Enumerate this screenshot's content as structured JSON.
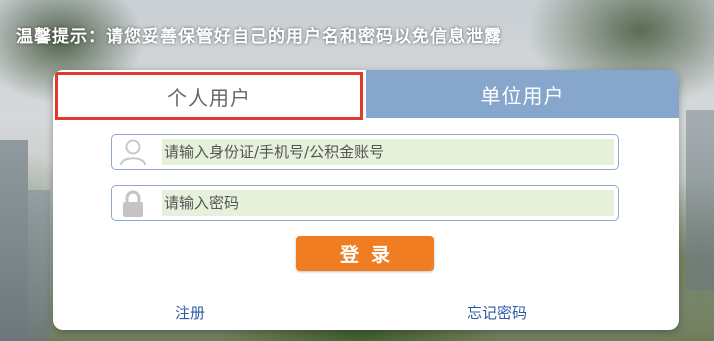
{
  "tip": "温馨提示：请您妥善保管好自己的用户名和密码以免信息泄露",
  "tabs": {
    "personal": "个人用户",
    "unit": "单位用户"
  },
  "form": {
    "username_placeholder": "请输入身份证/手机号/公积金账号",
    "password_placeholder": "请输入密码",
    "login_label": "登录"
  },
  "links": {
    "register": "注册",
    "forgot": "忘记密码"
  },
  "colors": {
    "active_tab_border": "#e03a2e",
    "inactive_tab_bg": "#87a6cc",
    "login_button": "#f07d22",
    "link": "#2d5aa5",
    "input_fill": "#e6f1dc"
  },
  "icons": {
    "username": "user-icon",
    "password": "lock-icon"
  }
}
